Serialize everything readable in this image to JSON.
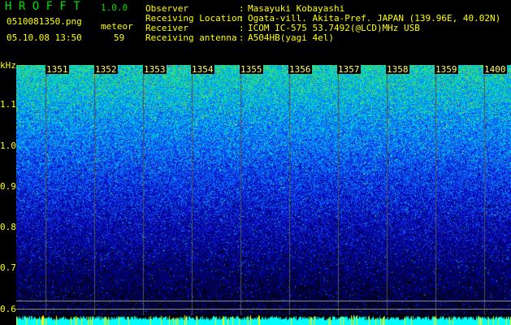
{
  "app": {
    "name": "H R O F F T",
    "version": "1.0.0"
  },
  "file": {
    "name": "0510081350.png",
    "datetime": "05.10.08 13:50"
  },
  "meteor": {
    "label": "meteor",
    "count": "59"
  },
  "info": [
    {
      "label": "Observer",
      "value": "Masayuki Kobayashi"
    },
    {
      "label": "Receiving Location",
      "value": "Ogata-vill. Akita-Pref. JAPAN (139.96E, 40.02N)"
    },
    {
      "label": "Receiver",
      "value": "ICOM IC-575 53.7492(@LCD)MHz USB"
    },
    {
      "label": "Receiving antenna",
      "value": "A504HB(yagi 4el)"
    }
  ],
  "y_axis": {
    "unit": "kHz",
    "ticks": [
      "1.1",
      "1.0",
      "0.9",
      "0.8",
      "0.7",
      "0.6"
    ]
  },
  "time_labels": [
    "1351",
    "1352",
    "1353",
    "1354",
    "1355",
    "1356",
    "1357",
    "1358",
    "1359",
    "1400"
  ],
  "colors": {
    "text": "#ffff00",
    "title": "#00e000",
    "level": "#00ffff"
  }
}
